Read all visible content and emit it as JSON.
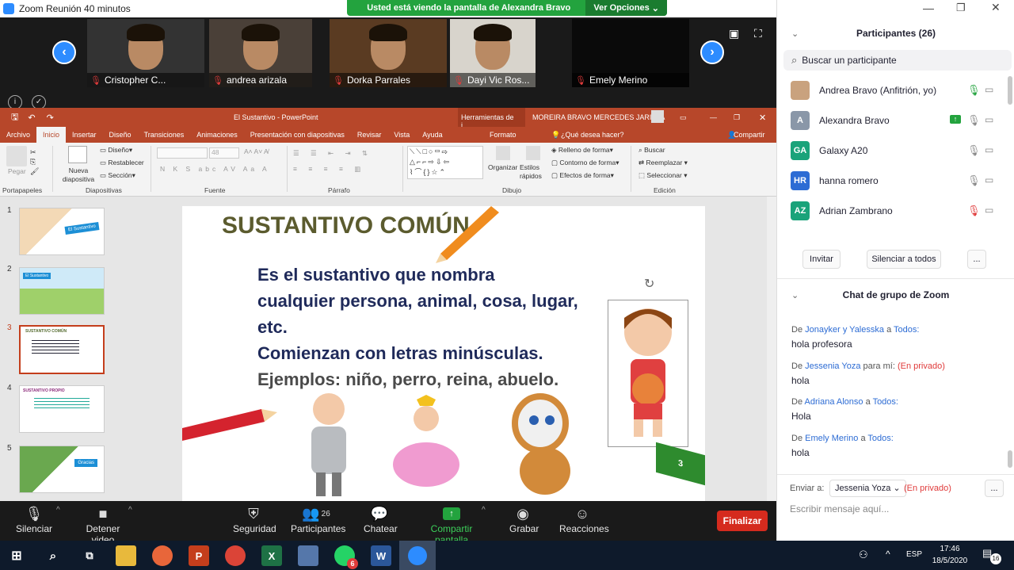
{
  "window": {
    "title": "Zoom Reunión 40 minutos"
  },
  "banner": {
    "message": "Usted está viendo la pantalla de Alexandra Bravo",
    "options": "Ver Opciones"
  },
  "videos": [
    {
      "name": "Cristopher C..."
    },
    {
      "name": "andrea arizala"
    },
    {
      "name": "Dorka Parrales"
    },
    {
      "name": "Dayi Vic Ros..."
    },
    {
      "name": "Emely Merino"
    }
  ],
  "ppt": {
    "title": "El Sustantivo  -  PowerPoint",
    "tools": "Herramientas de i...",
    "user": "MOREIRA BRAVO MERCEDES JARITZA",
    "tabs": [
      "Archivo",
      "Inicio",
      "Insertar",
      "Diseño",
      "Transiciones",
      "Animaciones",
      "Presentación con diapositivas",
      "Revisar",
      "Vista",
      "Ayuda"
    ],
    "format_tab": "Formato",
    "tell_me": "¿Qué desea hacer?",
    "share": "Compartir",
    "ribbon": {
      "paste": "Pegar",
      "new_slide": "Nueva diapositiva",
      "design": "Diseño",
      "reset": "Restablecer",
      "section": "Sección",
      "font_size": "48",
      "arrange": "Organizar",
      "quick_styles": "Estilos rápidos",
      "fill": "Relleno de forma",
      "outline": "Contorno de forma",
      "effects": "Efectos de forma",
      "find": "Buscar",
      "replace": "Reemplazar",
      "select": "Seleccionar",
      "groups": {
        "clipboard": "Portapapeles",
        "slides": "Diapositivas",
        "font": "Fuente",
        "paragraph": "Párrafo",
        "drawing": "Dibujo",
        "editing": "Edición"
      }
    },
    "thumbnails": [
      {
        "num": "1",
        "label": "El Sustantivo"
      },
      {
        "num": "2",
        "label": "El Sustantivo"
      },
      {
        "num": "3",
        "label": "SUSTANTIVO COMÚN"
      },
      {
        "num": "4",
        "label": "SUSTANTIVO PROPIO"
      },
      {
        "num": "5",
        "label": "Gracias"
      }
    ],
    "slide": {
      "heading": "SUSTANTIVO COMÚN",
      "line1": "Es el sustantivo que nombra",
      "line2": "cualquier persona, animal, cosa, lugar,",
      "line3": "etc.",
      "line4": "Comienzan con letras minúsculas.",
      "line5": "Ejemplos: niño, perro, reina, abuelo.",
      "page": "3"
    }
  },
  "zoom_toolbar": {
    "mute": "Silenciar",
    "video": "Detener video",
    "security": "Seguridad",
    "participants": "Participantes",
    "participants_count": "26",
    "chat": "Chatear",
    "share": "Compartir pantalla",
    "record": "Grabar",
    "reactions": "Reacciones",
    "end": "Finalizar"
  },
  "panel": {
    "participants_title": "Participantes (26)",
    "search_placeholder": "Buscar un participante",
    "participants": [
      {
        "initials": "",
        "name": "Andrea Bravo (Anfitrión, yo)",
        "color": "#c9a27e"
      },
      {
        "initials": "A",
        "name": "Alexandra Bravo",
        "color": "#8a97a8"
      },
      {
        "initials": "GA",
        "name": "Galaxy A20",
        "color": "#1aa37a"
      },
      {
        "initials": "HR",
        "name": "hanna romero",
        "color": "#2d6cd4"
      },
      {
        "initials": "AZ",
        "name": "Adrian Zambrano",
        "color": "#1aa37a"
      }
    ],
    "invite": "Invitar",
    "mute_all": "Silenciar a todos",
    "more": "...",
    "chat_title": "Chat de grupo de Zoom",
    "messages": [
      {
        "prefix": "De",
        "from": "Jonayker y Yalesska",
        "mid": "a",
        "to": "Todos:",
        "private": "",
        "text": "hola profesora"
      },
      {
        "prefix": "De",
        "from": "Jessenia Yoza",
        "mid": "para mí:",
        "to": "",
        "private": "(En privado)",
        "text": "hola"
      },
      {
        "prefix": "De",
        "from": "Adriana Alonso",
        "mid": "a",
        "to": "Todos:",
        "private": "",
        "text": "Hola"
      },
      {
        "prefix": "De",
        "from": "Emely Merino",
        "mid": "a",
        "to": "Todos:",
        "private": "",
        "text": "hola"
      }
    ],
    "send_to_label": "Enviar a:",
    "send_to": "Jessenia Yoza",
    "send_private": "(En privado)",
    "input_placeholder": "Escribir mensaje aquí..."
  },
  "taskbar": {
    "lang": "ESP",
    "time": "17:46",
    "date": "18/5/2020",
    "notif": "16",
    "whatsapp_badge": "6"
  }
}
